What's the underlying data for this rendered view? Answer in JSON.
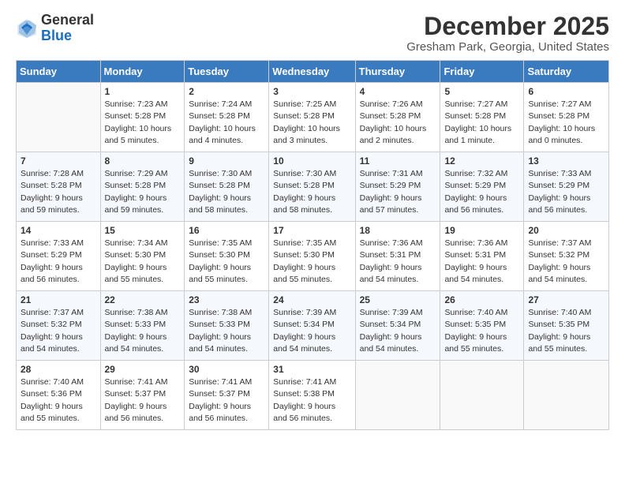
{
  "header": {
    "logo_line1": "General",
    "logo_line2": "Blue",
    "month_title": "December 2025",
    "location": "Gresham Park, Georgia, United States"
  },
  "weekdays": [
    "Sunday",
    "Monday",
    "Tuesday",
    "Wednesday",
    "Thursday",
    "Friday",
    "Saturday"
  ],
  "weeks": [
    [
      {
        "day": "",
        "info": ""
      },
      {
        "day": "1",
        "info": "Sunrise: 7:23 AM\nSunset: 5:28 PM\nDaylight: 10 hours\nand 5 minutes."
      },
      {
        "day": "2",
        "info": "Sunrise: 7:24 AM\nSunset: 5:28 PM\nDaylight: 10 hours\nand 4 minutes."
      },
      {
        "day": "3",
        "info": "Sunrise: 7:25 AM\nSunset: 5:28 PM\nDaylight: 10 hours\nand 3 minutes."
      },
      {
        "day": "4",
        "info": "Sunrise: 7:26 AM\nSunset: 5:28 PM\nDaylight: 10 hours\nand 2 minutes."
      },
      {
        "day": "5",
        "info": "Sunrise: 7:27 AM\nSunset: 5:28 PM\nDaylight: 10 hours\nand 1 minute."
      },
      {
        "day": "6",
        "info": "Sunrise: 7:27 AM\nSunset: 5:28 PM\nDaylight: 10 hours\nand 0 minutes."
      }
    ],
    [
      {
        "day": "7",
        "info": "Sunrise: 7:28 AM\nSunset: 5:28 PM\nDaylight: 9 hours\nand 59 minutes."
      },
      {
        "day": "8",
        "info": "Sunrise: 7:29 AM\nSunset: 5:28 PM\nDaylight: 9 hours\nand 59 minutes."
      },
      {
        "day": "9",
        "info": "Sunrise: 7:30 AM\nSunset: 5:28 PM\nDaylight: 9 hours\nand 58 minutes."
      },
      {
        "day": "10",
        "info": "Sunrise: 7:30 AM\nSunset: 5:28 PM\nDaylight: 9 hours\nand 58 minutes."
      },
      {
        "day": "11",
        "info": "Sunrise: 7:31 AM\nSunset: 5:29 PM\nDaylight: 9 hours\nand 57 minutes."
      },
      {
        "day": "12",
        "info": "Sunrise: 7:32 AM\nSunset: 5:29 PM\nDaylight: 9 hours\nand 56 minutes."
      },
      {
        "day": "13",
        "info": "Sunrise: 7:33 AM\nSunset: 5:29 PM\nDaylight: 9 hours\nand 56 minutes."
      }
    ],
    [
      {
        "day": "14",
        "info": "Sunrise: 7:33 AM\nSunset: 5:29 PM\nDaylight: 9 hours\nand 56 minutes."
      },
      {
        "day": "15",
        "info": "Sunrise: 7:34 AM\nSunset: 5:30 PM\nDaylight: 9 hours\nand 55 minutes."
      },
      {
        "day": "16",
        "info": "Sunrise: 7:35 AM\nSunset: 5:30 PM\nDaylight: 9 hours\nand 55 minutes."
      },
      {
        "day": "17",
        "info": "Sunrise: 7:35 AM\nSunset: 5:30 PM\nDaylight: 9 hours\nand 55 minutes."
      },
      {
        "day": "18",
        "info": "Sunrise: 7:36 AM\nSunset: 5:31 PM\nDaylight: 9 hours\nand 54 minutes."
      },
      {
        "day": "19",
        "info": "Sunrise: 7:36 AM\nSunset: 5:31 PM\nDaylight: 9 hours\nand 54 minutes."
      },
      {
        "day": "20",
        "info": "Sunrise: 7:37 AM\nSunset: 5:32 PM\nDaylight: 9 hours\nand 54 minutes."
      }
    ],
    [
      {
        "day": "21",
        "info": "Sunrise: 7:37 AM\nSunset: 5:32 PM\nDaylight: 9 hours\nand 54 minutes."
      },
      {
        "day": "22",
        "info": "Sunrise: 7:38 AM\nSunset: 5:33 PM\nDaylight: 9 hours\nand 54 minutes."
      },
      {
        "day": "23",
        "info": "Sunrise: 7:38 AM\nSunset: 5:33 PM\nDaylight: 9 hours\nand 54 minutes."
      },
      {
        "day": "24",
        "info": "Sunrise: 7:39 AM\nSunset: 5:34 PM\nDaylight: 9 hours\nand 54 minutes."
      },
      {
        "day": "25",
        "info": "Sunrise: 7:39 AM\nSunset: 5:34 PM\nDaylight: 9 hours\nand 54 minutes."
      },
      {
        "day": "26",
        "info": "Sunrise: 7:40 AM\nSunset: 5:35 PM\nDaylight: 9 hours\nand 55 minutes."
      },
      {
        "day": "27",
        "info": "Sunrise: 7:40 AM\nSunset: 5:35 PM\nDaylight: 9 hours\nand 55 minutes."
      }
    ],
    [
      {
        "day": "28",
        "info": "Sunrise: 7:40 AM\nSunset: 5:36 PM\nDaylight: 9 hours\nand 55 minutes."
      },
      {
        "day": "29",
        "info": "Sunrise: 7:41 AM\nSunset: 5:37 PM\nDaylight: 9 hours\nand 56 minutes."
      },
      {
        "day": "30",
        "info": "Sunrise: 7:41 AM\nSunset: 5:37 PM\nDaylight: 9 hours\nand 56 minutes."
      },
      {
        "day": "31",
        "info": "Sunrise: 7:41 AM\nSunset: 5:38 PM\nDaylight: 9 hours\nand 56 minutes."
      },
      {
        "day": "",
        "info": ""
      },
      {
        "day": "",
        "info": ""
      },
      {
        "day": "",
        "info": ""
      }
    ]
  ]
}
